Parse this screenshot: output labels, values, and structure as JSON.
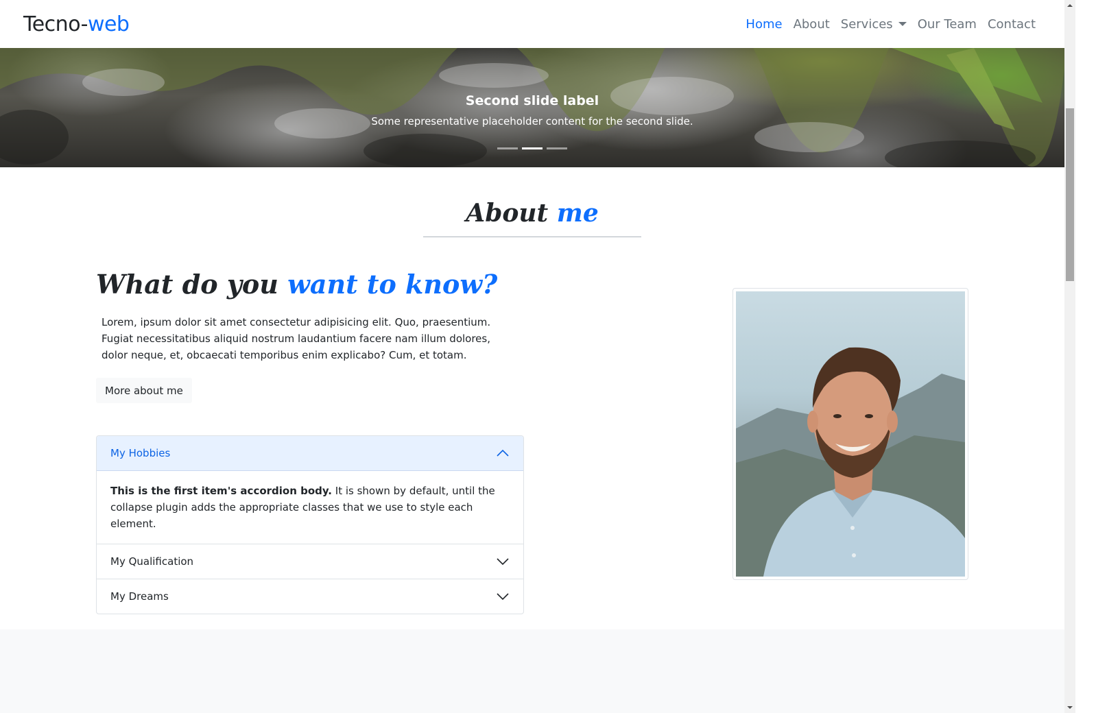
{
  "navbar": {
    "brand_main": "Tecno-",
    "brand_accent": "web",
    "links": [
      {
        "label": "Home"
      },
      {
        "label": "About"
      },
      {
        "label": "Services"
      },
      {
        "label": "Our Team"
      },
      {
        "label": "Contact"
      }
    ],
    "active_index": 0
  },
  "carousel": {
    "caption_title": "Second slide label",
    "caption_text": "Some representative placeholder content for the second slide.",
    "slide_count": 3,
    "active_slide": 2
  },
  "about": {
    "title_main": "About",
    "title_accent": "me",
    "subhead_main": "What do you",
    "subhead_accent": "want to know?",
    "paragraph": "Lorem, ipsum dolor sit amet consectetur adipisicing elit. Quo, praesentium. Fugiat necessitatibus aliquid nostrum laudantium facere nam illum dolores, dolor neque, et, obcaecati temporibus enim explicabo? Cum, et totam.",
    "button_label": "More about me"
  },
  "accordion": {
    "items": [
      {
        "title": "My Hobbies",
        "open": true,
        "body_bold": "This is the first item's accordion body.",
        "body_rest": " It is shown by default, until the collapse plugin adds the appropriate classes that we use to style each element."
      },
      {
        "title": "My Qualification",
        "open": false
      },
      {
        "title": "My Dreams",
        "open": false
      }
    ]
  },
  "colors": {
    "accent": "#0d6efd",
    "accordion_open_bg": "#e7f1ff",
    "muted_nav": "#6c757d"
  },
  "icons": {
    "services_dropdown": "caret-down-icon",
    "accordion_open": "chevron-up-icon",
    "accordion_closed": "chevron-down-icon"
  }
}
